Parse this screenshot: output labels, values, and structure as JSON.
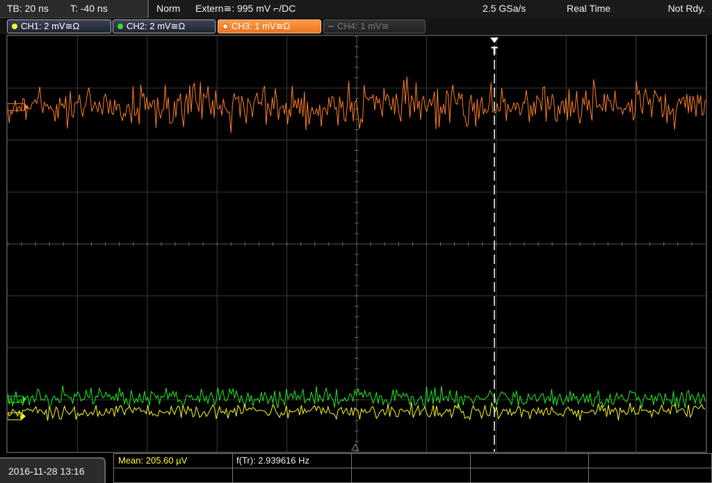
{
  "header": {
    "timebase": "TB: 20 ns",
    "trigger_time": "T: -40 ns",
    "mode": "Norm",
    "trigger": "Extern≅: 995 mV ⌐/DC",
    "sample_rate": "2.5 GSa/s",
    "acquisition": "Real Time",
    "state": "Not Rdy."
  },
  "channels": [
    {
      "label": "CH1: 2 mV≅Ω",
      "color": "#ffff33",
      "active": true
    },
    {
      "label": "CH2: 2 mV≅Ω",
      "color": "#33dd33",
      "active": true
    },
    {
      "label": "CH3: 1 mV≅Ω",
      "color": "#ff8c3a",
      "active": true,
      "selected": true
    },
    {
      "label": "CH4: 1 mV≅",
      "color": "#666666",
      "active": false
    }
  ],
  "waveform_colors": {
    "ch1": "#ffff22",
    "ch2": "#22ee22",
    "ch3": "#ff7f2a",
    "grid": "#3a3a3a",
    "trigger_marker": "#ffffff"
  },
  "markers": {
    "trigger_label": "T"
  },
  "footer": {
    "datetime": "2016-11-28 13:16",
    "measurements": [
      {
        "label": "Mean: 205.60 µV"
      },
      {
        "label": "f(Tr): 2.939616 Hz"
      }
    ]
  }
}
